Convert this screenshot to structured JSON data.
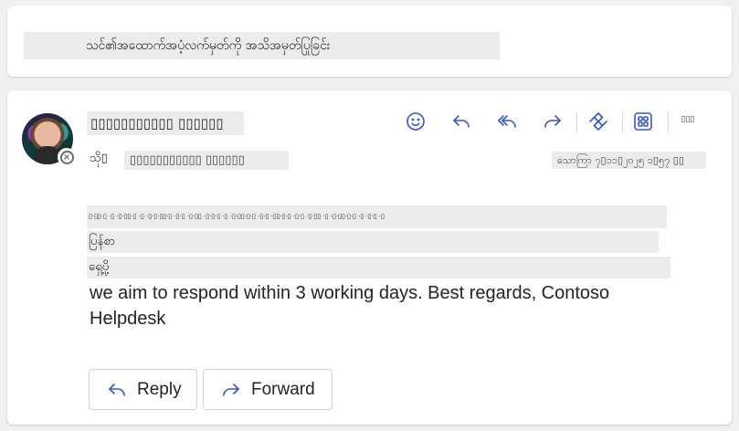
{
  "subject": "သင်၏အထောက်အပံ့လက်မှတ်ကို အသိအမှတ်ပြုခြင်း",
  "message": {
    "sender_name": "▯▯▯▯▯▯▯▯▯▯▯ ▯▯▯▯▯▯",
    "to_label": "သို▯",
    "recipient": "▯▯▯▯▯▯▯▯▯▯▯ ▯▯▯▯▯▯",
    "timestamp": "သောကြာ ၇▯၁၁▯၂၀၂၅ ၁▯၅၇ ▯▯",
    "body_line": "▯·▯▯·▯ ·▯ ·▯·▯▯·▯ ·▯ ·▯·▯·▯▯·▯ ·▯·▯ ·▯·▯▯ ·▯·▯·▯ ·▯ ·▯·▯▯·▯·▯ ·▯·▯ ·▯▯·▯·▯ ·▯·▯ ·▯·▯▯ ·▯ ·▯·▯▯·▯·▯ ·▯ ·▯·▯ ·▯",
    "body_reply": "ပြန်စာ",
    "body_address": "ရှေ့ပို့",
    "body_text": "we aim to respond within 3 working days. Best regards, Contoso Helpdesk",
    "more_actions": "▯▯▯"
  },
  "actions": {
    "reply_label": "Reply",
    "forward_label": "Forward"
  },
  "colors": {
    "accent": "#3957c3",
    "placeholder_bg": "#ececec",
    "page_bg": "#f0f0f0"
  }
}
